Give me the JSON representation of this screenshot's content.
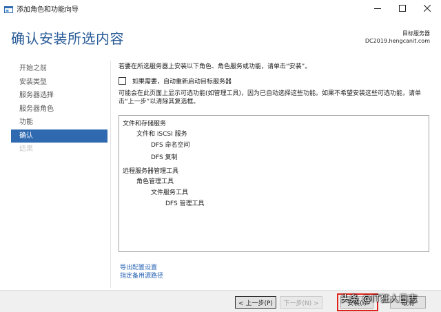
{
  "window": {
    "title": "添加角色和功能向导",
    "controls": {
      "minimize_icon": "minimize-icon",
      "maximize_icon": "maximize-icon",
      "close_icon": "close-icon"
    }
  },
  "header": {
    "title": "确认安装所选内容",
    "target_label": "目标服务器",
    "target_value": "DC2019.hengcanit.com"
  },
  "nav": {
    "items": [
      {
        "label": "开始之前",
        "state": "normal"
      },
      {
        "label": "安装类型",
        "state": "normal"
      },
      {
        "label": "服务器选择",
        "state": "normal"
      },
      {
        "label": "服务器角色",
        "state": "normal"
      },
      {
        "label": "功能",
        "state": "normal"
      },
      {
        "label": "确认",
        "state": "active"
      },
      {
        "label": "结果",
        "state": "disabled"
      }
    ]
  },
  "content": {
    "intro": "若要在所选服务器上安装以下角色、角色服务或功能，请单击“安装”。",
    "restart_checkbox": {
      "label": "如果需要，自动重新启动目标服务器",
      "checked": false
    },
    "note": "可能会在此页面上显示可选功能(如管理工具)，因为已自动选择这些功能。如果不希望安装这些可选功能，请单击“上一步”以清除其复选框。",
    "selections": [
      {
        "text": "文件和存储服务",
        "level": 0
      },
      {
        "text": "文件和 iSCSI 服务",
        "level": 1
      },
      {
        "text": "DFS 命名空间",
        "level": 2
      },
      {
        "text": "DFS 复制",
        "level": 2
      },
      {
        "text": "远程服务器管理工具",
        "level": 0
      },
      {
        "text": "角色管理工具",
        "level": 1
      },
      {
        "text": "文件服务工具",
        "level": 2
      },
      {
        "text": "DFS 管理工具",
        "level": 3
      }
    ],
    "links": {
      "export": "导出配置设置",
      "alternate_source": "指定备用源路径"
    }
  },
  "footer": {
    "prev": "< 上一步(P)",
    "next": "下一步(N) >",
    "install": "安装(I)",
    "cancel": "取消"
  },
  "watermark": "头条 @IT狂人日志",
  "colors": {
    "title_blue": "#2a5c98",
    "nav_active_bg": "#2f6ab1",
    "link_blue": "#2a64b5",
    "highlight_red": "#e0241b"
  }
}
